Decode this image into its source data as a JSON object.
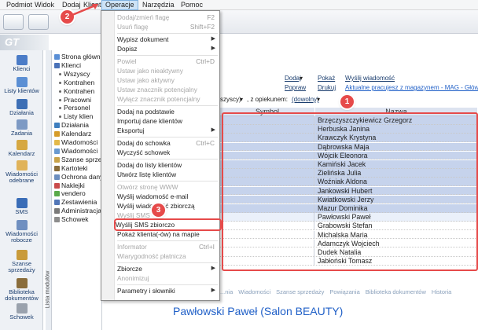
{
  "menubar": [
    "Podmiot",
    "Widok",
    "Dodaj",
    "Klient",
    "Operacje",
    "Narzędzia",
    "Pomoc"
  ],
  "left_nav": [
    "Klienci",
    "Listy klientów",
    "Działania",
    "Zadania",
    "Kalendarz",
    "Wiadomości odebrane",
    "SMS",
    "Wiadomości robocze",
    "Szanse sprzedaży",
    "Biblioteka dokumentów",
    "Schowek"
  ],
  "tree": {
    "vertical_tab": "Lista modułów",
    "items": [
      {
        "label": "Strona główn",
        "color": "#5a8fd6"
      },
      {
        "label": "Klienci",
        "color": "#4a72b8"
      },
      {
        "label": "Wszyscy",
        "sub": true
      },
      {
        "label": "Kontrahen",
        "sub": true
      },
      {
        "label": "Kontrahen",
        "sub": true
      },
      {
        "label": "Pracowni",
        "sub": true
      },
      {
        "label": "Personel",
        "sub": true
      },
      {
        "label": "Listy klien",
        "sub": true
      },
      {
        "label": "Działania",
        "color": "#3f7fbf"
      },
      {
        "label": "Kalendarz",
        "color": "#d69c2a"
      },
      {
        "label": "Wiadomości",
        "color": "#e3b94a"
      },
      {
        "label": "Wiadomości",
        "color": "#6a9ad0"
      },
      {
        "label": "Szanse sprzed",
        "color": "#c9a349"
      },
      {
        "label": "Kartoteki",
        "color": "#8a6d3b"
      },
      {
        "label": "Ochrona dany",
        "color": "#6c8ebf"
      },
      {
        "label": "Naklejki",
        "color": "#c94b4b"
      },
      {
        "label": "vendero",
        "color": "#5aaa4a"
      },
      {
        "label": "Zestawienia",
        "color": "#5277b8"
      },
      {
        "label": "Administracja",
        "color": "#7a7a7a"
      },
      {
        "label": "Schowek",
        "color": "#8d8d8d"
      }
    ]
  },
  "header": {
    "dodaj": "Dodaj",
    "pokaz": "Pokaż",
    "wyslij_wiadomosc": "Wyślij wiadomość",
    "popraw": "Popraw",
    "drukuj": "Drukuj",
    "aktualne_link": "Aktualne pracujesz z magazynem - MAG - Główny",
    "filter_value": "szyscy)",
    "filter_label": ", z opiekunem:",
    "filter_option": "(dowolny)"
  },
  "menu": {
    "items": [
      {
        "label": "Dodaj/zmień flagę",
        "shortcut": "F2",
        "disabled": true
      },
      {
        "label": "Usuń flagę",
        "shortcut": "Shift+F2",
        "disabled": true
      },
      {
        "sep": true
      },
      {
        "label": "Wypisz dokument",
        "submenu": true
      },
      {
        "label": "Dopisz",
        "submenu": true
      },
      {
        "sep": true
      },
      {
        "label": "Powiel",
        "shortcut": "Ctrl+D",
        "disabled": true
      },
      {
        "label": "Ustaw jako nieaktywny",
        "disabled": true
      },
      {
        "label": "Ustaw jako aktywny",
        "disabled": true
      },
      {
        "label": "Ustaw znacznik potencjalny",
        "disabled": true
      },
      {
        "label": "Wyłącz znacznik potencjalny",
        "disabled": true
      },
      {
        "sep": true
      },
      {
        "label": "Dodaj na podstawie"
      },
      {
        "label": "Importuj dane klientów"
      },
      {
        "label": "Eksportuj",
        "submenu": true
      },
      {
        "sep": true
      },
      {
        "label": "Dodaj do schowka",
        "shortcut": "Ctrl+C"
      },
      {
        "label": "Wyczyść schowek"
      },
      {
        "sep": true
      },
      {
        "label": "Dodaj do listy klientów"
      },
      {
        "label": "Utwórz listę klientów"
      },
      {
        "sep": true
      },
      {
        "label": "Otwórz stronę WWW",
        "disabled": true
      },
      {
        "label": "Wyślij wiadomość e-mail"
      },
      {
        "label": "Wyślij wiadomość zbiorczą"
      },
      {
        "label": "Wyślij SMS",
        "disabled": true
      },
      {
        "label": "Wyślij SMS zbiorczo",
        "highlight": true
      },
      {
        "label": "Pokaż klienta(-ów) na mapie"
      },
      {
        "sep": true
      },
      {
        "label": "Informator",
        "shortcut": "Ctrl+I",
        "disabled": true
      },
      {
        "label": "Wiarygodność płatnicza",
        "disabled": true
      },
      {
        "sep": true
      },
      {
        "label": "Zbiorcze",
        "submenu": true
      },
      {
        "label": "Anonimizuj",
        "disabled": true
      },
      {
        "sep": true
      },
      {
        "label": "Parametry i słowniki",
        "submenu": true
      }
    ]
  },
  "grid": {
    "columns": [
      "Symbol",
      "Nazwa"
    ],
    "rows": [
      {
        "name": "Brzęczyszczykiewicz Grzegorz",
        "state": "sel"
      },
      {
        "name": "Herbuska Janina",
        "state": "sel"
      },
      {
        "name": "Krawczyk Krystyna",
        "state": "sel"
      },
      {
        "name": "Dąbrowska Maja",
        "state": "sel"
      },
      {
        "name": "Wójcik Eleonora",
        "state": "sel"
      },
      {
        "name": "Kamiński Jacek",
        "state": "sel"
      },
      {
        "name": "Zielińska Julia",
        "state": "sel"
      },
      {
        "name": "Woźniak Aldona",
        "state": "sel"
      },
      {
        "name": "Jankowski Hubert",
        "state": "sel"
      },
      {
        "name": "Kwiatkowski Jerzy",
        "state": "sel"
      },
      {
        "name": "Mazur Dominika",
        "state": "sel"
      },
      {
        "name": "Pawłowski Paweł",
        "state": "cur"
      },
      {
        "name": "Grabowski Stefan",
        "state": ""
      },
      {
        "name": "Michalska Maria",
        "state": ""
      },
      {
        "name": "Adamczyk Wojciech",
        "state": ""
      },
      {
        "name": "Dudek Natalia",
        "state": ""
      },
      {
        "name": "Jabłoński Tomasz",
        "state": ""
      }
    ]
  },
  "detail_tabs": [
    "...nia",
    "Wiadomości",
    "Szanse sprzedaży",
    "Powiązania",
    "Biblioteka dokumentów",
    "Historia"
  ],
  "detail": {
    "name": "Pawłowski Paweł",
    "company": "(Salon BEAUTY)"
  },
  "badges": [
    "1",
    "2",
    "3"
  ],
  "colors": {
    "accent": "#1f5fc7",
    "annotation": "#e64a4a",
    "selection": "#c6d3ec"
  }
}
